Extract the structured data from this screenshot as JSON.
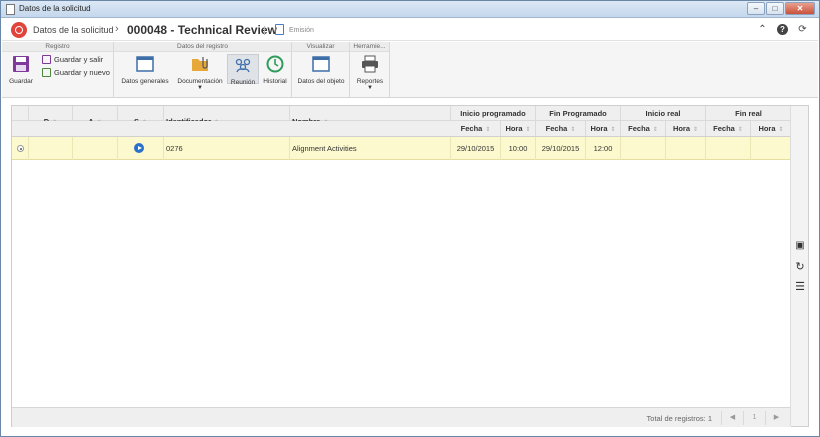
{
  "window": {
    "title": "Datos de la solicitud",
    "buttons": [
      "–",
      "□",
      "✕"
    ]
  },
  "header": {
    "breadcrumb_root": "Datos de la solicitud",
    "separator": "›",
    "record_title": "000048 - Technical Review",
    "status": "Emisión"
  },
  "ribbon": {
    "groups": {
      "registro": "Registro",
      "datos_registro": "Datos del registro",
      "visualizar": "Visualizar",
      "herramientas": "Herramie..."
    },
    "guardar": "Guardar",
    "guardar_salir": "Guardar y salir",
    "guardar_nuevo": "Guardar y nuevo",
    "datos_generales": "Datos generales",
    "documentacion": "Documentación",
    "reunion": "Reunión",
    "historial": "Historial",
    "datos_objeto": "Datos del objeto",
    "reportes": "Reportes"
  },
  "table": {
    "group_headers": {
      "inicio_programado": "Inicio programado",
      "fin_programado": "Fin Programado",
      "inicio_real": "Inicio real",
      "fin_real": "Fin real"
    },
    "columns": {
      "d": "D",
      "a": "A",
      "s": "S",
      "identificador": "Identificador",
      "nombre": "Nombre",
      "fecha": "Fecha",
      "hora": "Hora"
    },
    "rows": [
      {
        "identificador": "0276",
        "nombre": "Alignment Activities",
        "inicio_prog_fecha": "29/10/2015",
        "inicio_prog_hora": "10:00",
        "fin_prog_fecha": "29/10/2015",
        "fin_prog_hora": "12:00"
      }
    ]
  },
  "footer": {
    "total": "Total de registros: 1",
    "page": "1"
  },
  "colors": {
    "selected_row": "#fcf9cf",
    "logo": "#e0443b",
    "accent": "#2a72c9",
    "save_purple": "#7e3a9a"
  }
}
